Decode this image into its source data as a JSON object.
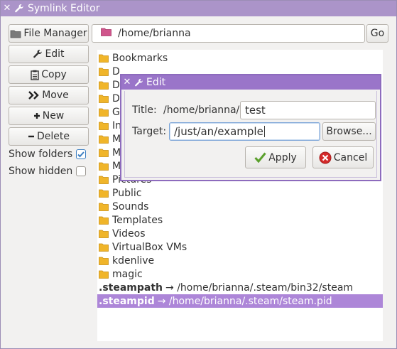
{
  "window": {
    "title": "Symlink Editor"
  },
  "sidebar": {
    "file_manager": "File Manager",
    "edit": "Edit",
    "copy": "Copy",
    "move": "Move",
    "new": "New",
    "delete": "Delete",
    "show_folders": "Show folders",
    "show_folders_checked": true,
    "show_hidden": "Show hidden",
    "show_hidden_checked": false
  },
  "pathbar": {
    "path": "/home/brianna",
    "go": "Go"
  },
  "files": [
    {
      "name": "Bookmarks",
      "type": "folder"
    },
    {
      "name": "D",
      "type": "folder"
    },
    {
      "name": "D",
      "type": "folder"
    },
    {
      "name": "D",
      "type": "folder"
    },
    {
      "name": "G",
      "type": "folder"
    },
    {
      "name": "In",
      "type": "folder"
    },
    {
      "name": "M",
      "type": "folder"
    },
    {
      "name": "M",
      "type": "folder"
    },
    {
      "name": "M",
      "type": "folder"
    },
    {
      "name": "Pictures",
      "type": "folder"
    },
    {
      "name": "Public",
      "type": "folder"
    },
    {
      "name": "Sounds",
      "type": "folder"
    },
    {
      "name": "Templates",
      "type": "folder"
    },
    {
      "name": "Videos",
      "type": "folder"
    },
    {
      "name": "VirtualBox VMs",
      "type": "folder"
    },
    {
      "name": "kdenlive",
      "type": "folder"
    },
    {
      "name": "magic",
      "type": "folder"
    },
    {
      "name": ".steampath",
      "target": "→ /home/brianna/.steam/bin32/steam",
      "type": "link"
    },
    {
      "name": ".steampid",
      "target": "→ /home/brianna/.steam/steam.pid",
      "type": "link",
      "selected": true
    }
  ],
  "dialog": {
    "title": "Edit",
    "title_label": "Title:",
    "title_prefix": "/home/brianna/",
    "title_value": "test",
    "target_label": "Target:",
    "target_value": "/just/an/example",
    "browse": "Browse...",
    "apply": "Apply",
    "cancel": "Cancel"
  },
  "colors": {
    "titlebar": "#ab94c9",
    "dialog_titlebar": "#9a75c9",
    "selection": "#ad86d8",
    "folder": "#f0b52a",
    "path_folder": "#d0558c"
  },
  "icons": {
    "close": "close-icon",
    "wrench": "wrench-icon",
    "folder": "folder-icon",
    "clipboard": "clipboard-icon",
    "move": "double-chevron-right-icon",
    "plus": "plus-icon",
    "minus": "minus-icon",
    "check": "checkmark-icon",
    "cancel": "cancel-icon"
  }
}
